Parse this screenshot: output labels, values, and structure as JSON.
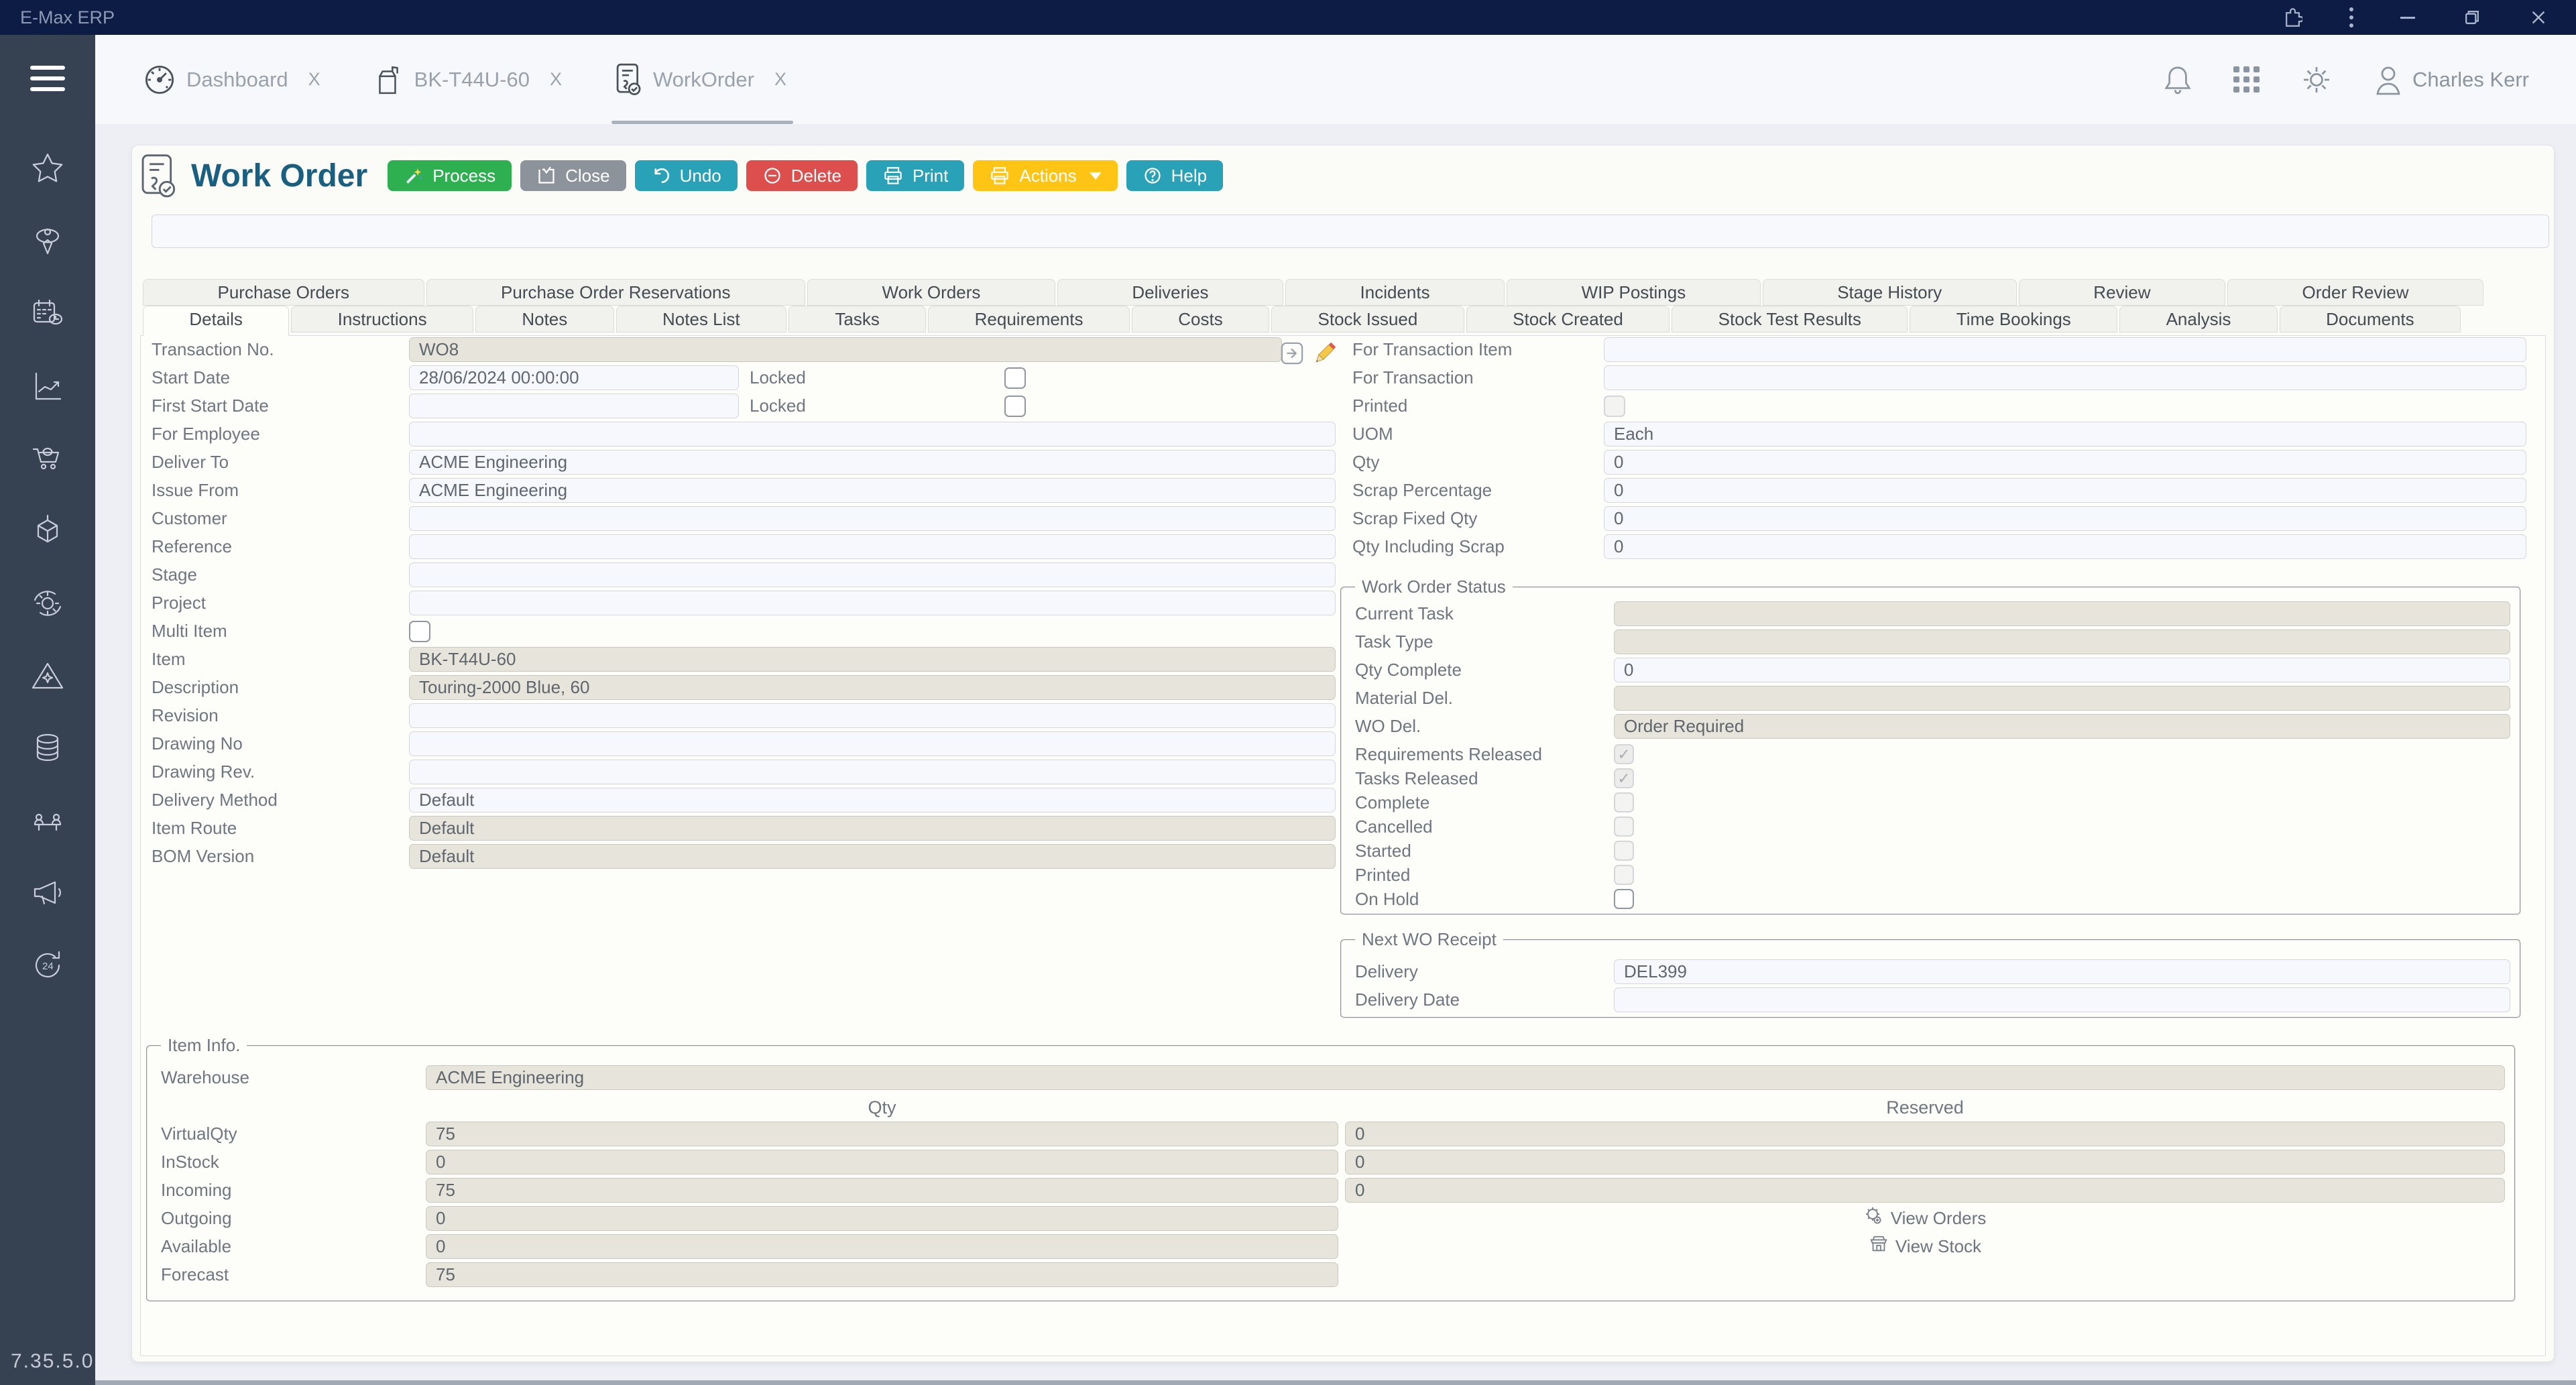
{
  "titlebar": {
    "app_name": "E-Max ERP"
  },
  "header": {
    "tabs": [
      {
        "label": "Dashboard",
        "active": false
      },
      {
        "label": "BK-T44U-60",
        "active": false
      },
      {
        "label": "WorkOrder",
        "active": true
      }
    ],
    "tab_close": "X",
    "user_name": "Charles Kerr"
  },
  "page": {
    "title": "Work Order"
  },
  "toolbar": {
    "buttons": [
      {
        "label": "Process",
        "color": "#2EB050"
      },
      {
        "label": "Close",
        "color": "#8C939B"
      },
      {
        "label": "Undo",
        "color": "#29A2B8"
      },
      {
        "label": "Delete",
        "color": "#DD4F4C"
      },
      {
        "label": "Print",
        "color": "#29A2B8"
      },
      {
        "label": "Actions",
        "color": "#FFC414",
        "has_dropdown": true
      },
      {
        "label": "Help",
        "color": "#29A2B8"
      }
    ]
  },
  "tabs_top": [
    "Purchase Orders",
    "Purchase Order Reservations",
    "Work Orders",
    "Deliveries",
    "Incidents",
    "WIP Postings",
    "Stage History",
    "Review",
    "Order Review"
  ],
  "tabs_bottom": [
    "Details",
    "Instructions",
    "Notes",
    "Notes List",
    "Tasks",
    "Requirements",
    "Costs",
    "Stock Issued",
    "Stock Created",
    "Stock Test Results",
    "Time Bookings",
    "Analysis",
    "Documents"
  ],
  "active_bottom_tab": "Details",
  "form": {
    "left": [
      {
        "label": "Transaction No.",
        "value": "WO8",
        "readonly": true,
        "cls": "w-trans"
      },
      {
        "label": "Start Date",
        "value": "28/06/2024 00:00:00",
        "cls": "w-date",
        "locked": "Locked"
      },
      {
        "label": "First Start Date",
        "value": "",
        "cls": "w-date",
        "locked": "Locked"
      },
      {
        "label": "For Employee",
        "value": ""
      },
      {
        "label": "Deliver To",
        "value": "ACME Engineering"
      },
      {
        "label": "Issue From",
        "value": "ACME Engineering"
      },
      {
        "label": "Customer",
        "value": ""
      },
      {
        "label": "Reference",
        "value": ""
      },
      {
        "label": "Stage",
        "value": ""
      },
      {
        "label": "Project",
        "value": ""
      },
      {
        "label": "Multi Item",
        "type": "checkbox",
        "checked": false,
        "disabled": false
      },
      {
        "label": "Item",
        "value": "BK-T44U-60",
        "readonly": true
      },
      {
        "label": "Description",
        "value": "Touring-2000 Blue, 60",
        "readonly": true
      },
      {
        "label": "Revision",
        "value": ""
      },
      {
        "label": "Drawing No",
        "value": ""
      },
      {
        "label": "Drawing Rev.",
        "value": ""
      },
      {
        "label": "Delivery Method",
        "value": "Default"
      },
      {
        "label": "Item Route",
        "value": "Default",
        "readonly": true
      },
      {
        "label": "BOM Version",
        "value": "Default",
        "readonly": true
      }
    ],
    "right": [
      {
        "label": "For Transaction Item",
        "value": ""
      },
      {
        "label": "For Transaction",
        "value": ""
      },
      {
        "label": "Printed",
        "type": "checkbox",
        "checked": false,
        "disabled": true
      },
      {
        "label": "UOM",
        "value": "Each"
      },
      {
        "label": "Qty",
        "value": "0"
      },
      {
        "label": "Scrap Percentage",
        "value": "0"
      },
      {
        "label": "Scrap Fixed Qty",
        "value": "0"
      },
      {
        "label": "Qty Including Scrap",
        "value": "0"
      }
    ]
  },
  "status": {
    "legend": "Work Order Status",
    "fields": [
      {
        "label": "Current Task",
        "value": "",
        "readonly": true
      },
      {
        "label": "Task Type",
        "value": "",
        "readonly": true
      },
      {
        "label": "Qty Complete",
        "value": "0"
      },
      {
        "label": "Material Del.",
        "value": "",
        "readonly": true
      },
      {
        "label": "WO Del.",
        "value": "Order Required",
        "readonly": true
      }
    ],
    "checks": [
      {
        "label": "Requirements Released",
        "checked": true,
        "disabled": true
      },
      {
        "label": "Tasks Released",
        "checked": true,
        "disabled": true
      },
      {
        "label": "Complete",
        "checked": false,
        "disabled": true
      },
      {
        "label": "Cancelled",
        "checked": false,
        "disabled": true
      },
      {
        "label": "Started",
        "checked": false,
        "disabled": true
      },
      {
        "label": "Printed",
        "checked": false,
        "disabled": true
      },
      {
        "label": "On Hold",
        "checked": false,
        "disabled": false
      }
    ]
  },
  "receipt": {
    "legend": "Next WO Receipt",
    "fields": [
      {
        "label": "Delivery",
        "value": "DEL399"
      },
      {
        "label": "Delivery Date",
        "value": ""
      }
    ]
  },
  "item_info": {
    "legend": "Item Info.",
    "warehouse": {
      "label": "Warehouse",
      "value": "ACME Engineering"
    },
    "col_qty": "Qty",
    "col_reserved": "Reserved",
    "rows": [
      {
        "label": "VirtualQty",
        "qty": "75",
        "reserved": "0"
      },
      {
        "label": "InStock",
        "qty": "0",
        "reserved": "0"
      },
      {
        "label": "Incoming",
        "qty": "75",
        "reserved": "0"
      },
      {
        "label": "Outgoing",
        "qty": "0",
        "link": "View Orders",
        "icon": "orders"
      },
      {
        "label": "Available",
        "qty": "0",
        "link": "View Stock",
        "icon": "stock"
      },
      {
        "label": "Forecast",
        "qty": "75"
      }
    ]
  },
  "sidebar": {
    "icons": [
      "favorites",
      "profile",
      "planner",
      "analytics",
      "purchases",
      "inventory",
      "processes",
      "alerts",
      "database",
      "meetings",
      "announcements",
      "support"
    ]
  },
  "version": "7.35.5.0",
  "colors": {
    "titlebar": "#0D1C44",
    "sidebar": "#364152",
    "title_text": "#1A5E80",
    "readonly_field": "#E6E4DB",
    "editable_field": "#F6F8FD"
  }
}
